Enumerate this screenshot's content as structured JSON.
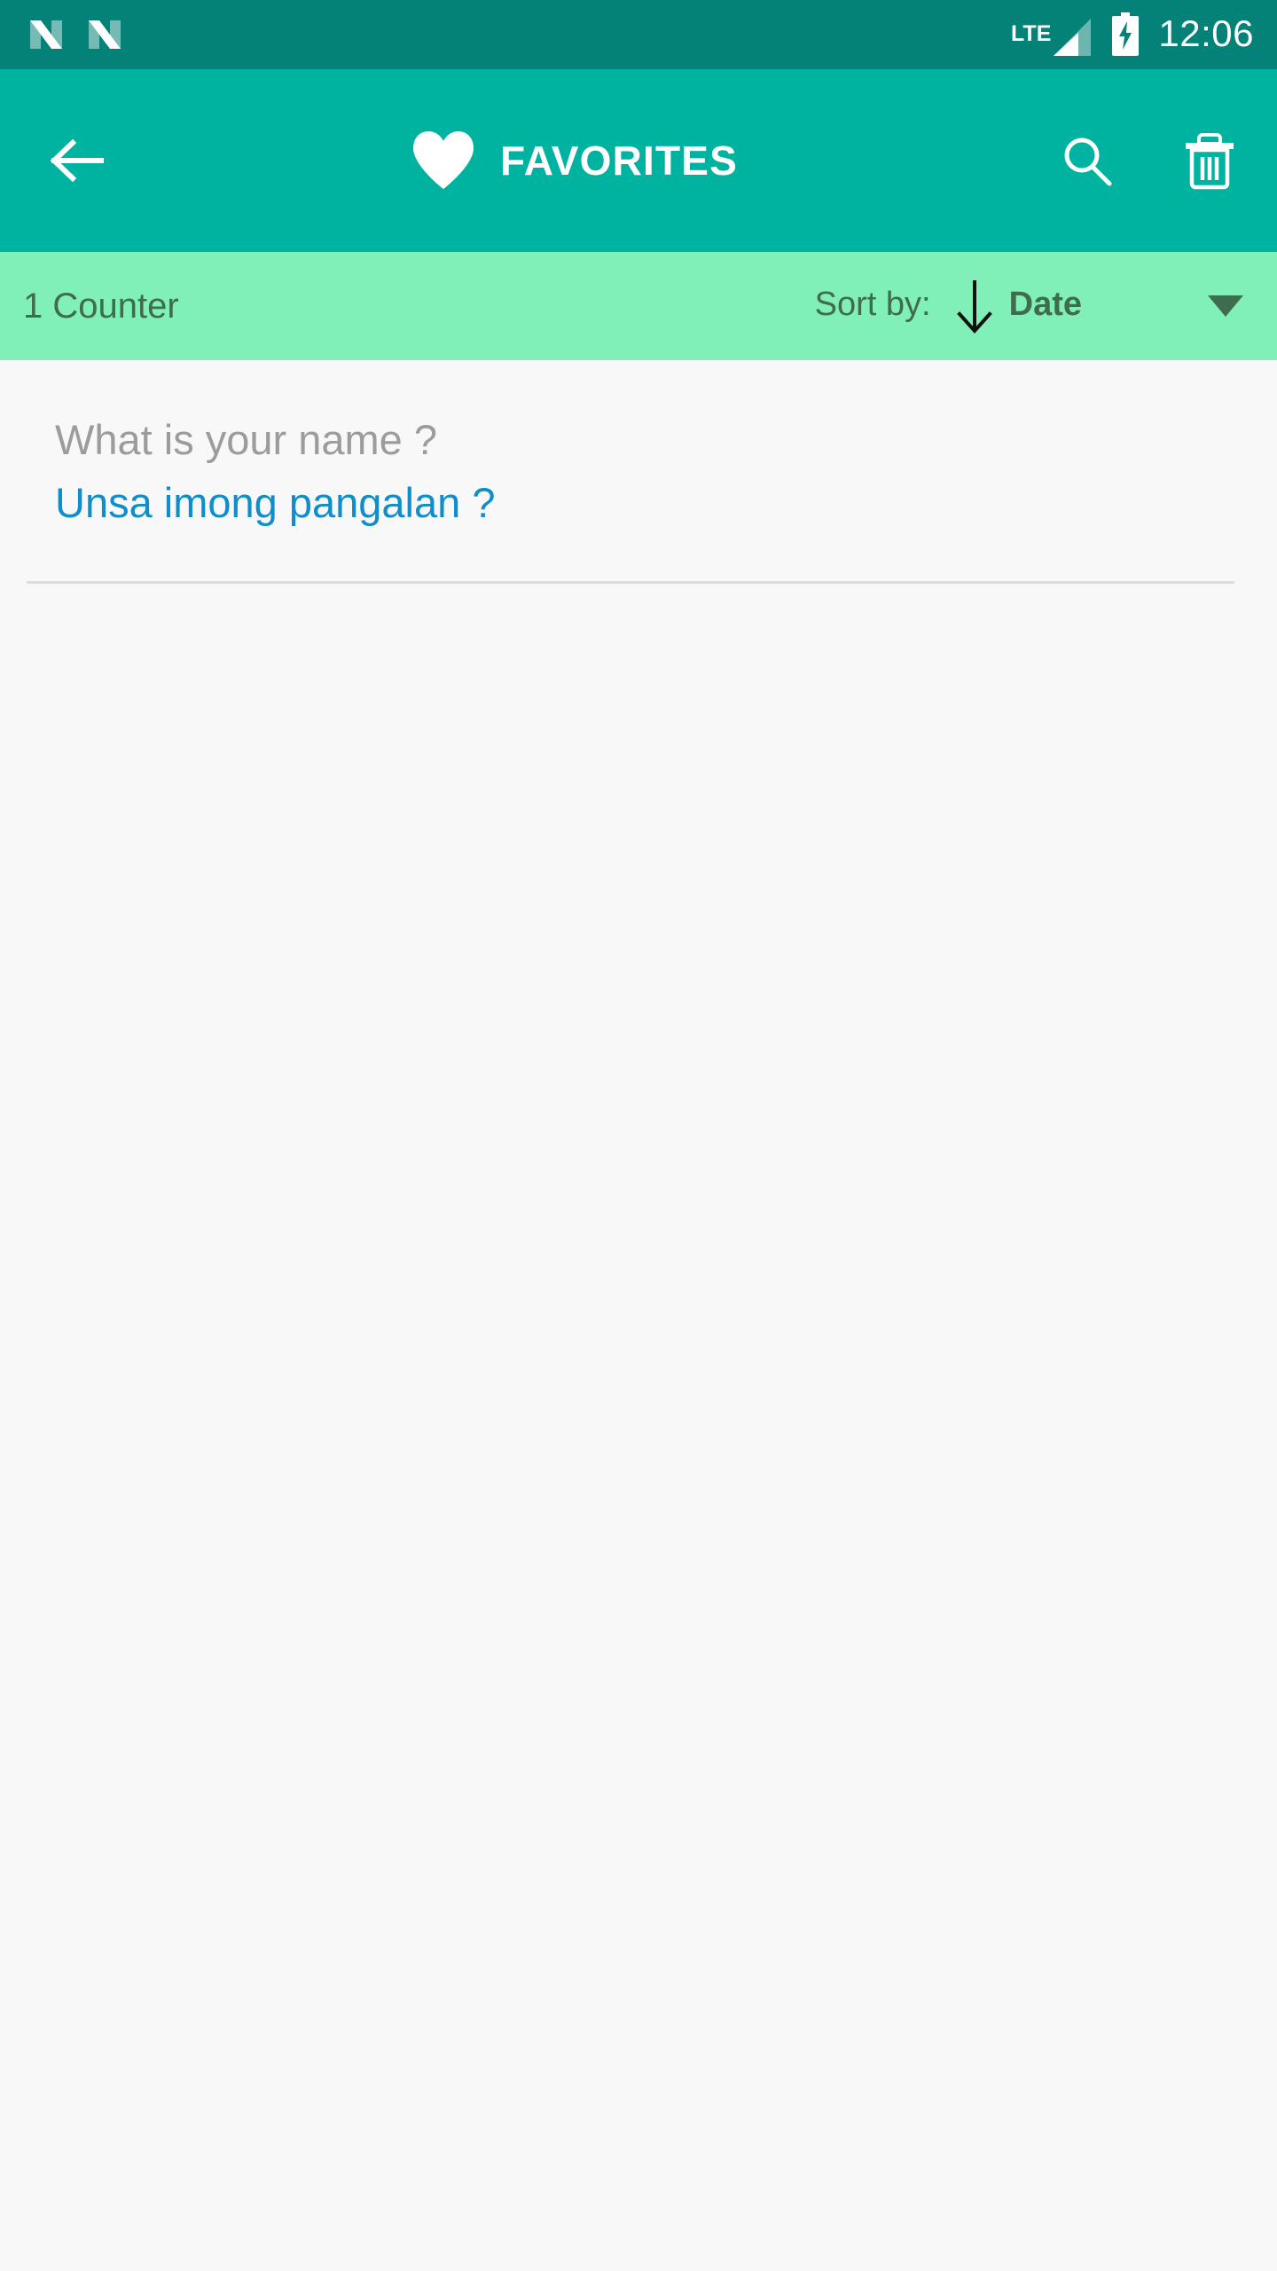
{
  "status_bar": {
    "notifications": [
      {
        "icon": "nougat-n-icon"
      },
      {
        "icon": "nougat-n-icon"
      }
    ],
    "network_label": "LTE",
    "signal_icon": "signal-bars-icon",
    "battery_icon": "battery-charging-icon",
    "time": "12:06",
    "background_color": "#058277",
    "foreground_color": "#ffffff"
  },
  "app_bar": {
    "back_icon": "arrow-left-icon",
    "title_icon": "heart-icon",
    "title": "FAVORITES",
    "actions": [
      {
        "icon": "search-icon",
        "label": "Search"
      },
      {
        "icon": "trash-icon",
        "label": "Delete"
      }
    ],
    "background_color": "#00b3a0",
    "foreground_color": "#ffffff"
  },
  "sort_bar": {
    "counter_text": "1 Counter",
    "sort_by_label": "Sort by:",
    "sort_direction_icon": "arrow-down-icon",
    "sort_value": "Date",
    "dropdown_icon": "caret-down-icon",
    "background_color": "#80f0b8",
    "text_color": "#3f6b4f"
  },
  "list": {
    "items": [
      {
        "source_text": "What is your name ?",
        "target_text": "Unsa imong pangalan ?",
        "source_color": "#9c9c9c",
        "target_color": "#0f8ecb"
      }
    ],
    "background_color": "#f8f8f8",
    "divider_color": "#dcdcdc"
  }
}
